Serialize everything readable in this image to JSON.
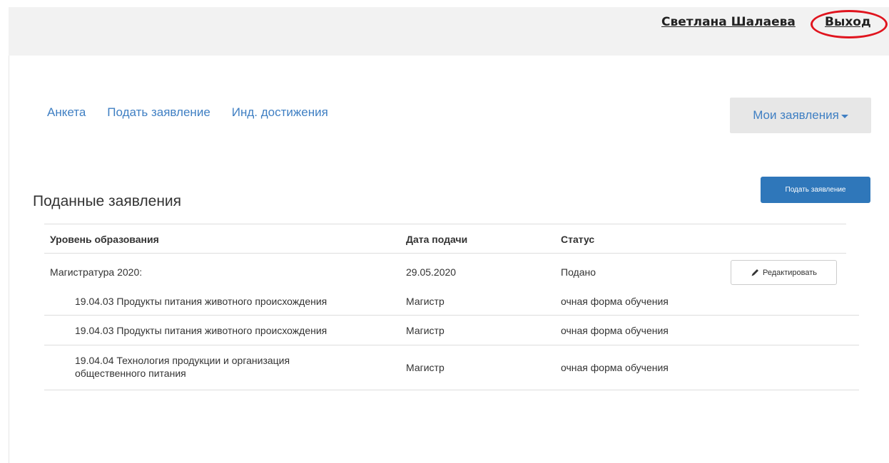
{
  "header": {
    "user_name": "Светлана Шалаева",
    "logout_label": "Выход"
  },
  "nav": {
    "items": [
      "Анкета",
      "Подать заявление",
      "Инд. достижения"
    ],
    "dropdown_label": "Мои заявления"
  },
  "main": {
    "title": "Поданные заявления",
    "submit_button_label": "Подать заявление",
    "table": {
      "columns": [
        "Уровень образования",
        "Дата подачи",
        "Статус"
      ],
      "group": {
        "name": "Магистратура 2020:",
        "date": "29.05.2020",
        "status": "Подано",
        "edit_label": "Редактировать"
      },
      "rows": [
        {
          "program": "19.04.03 Продукты питания животного происхождения",
          "degree": "Магистр",
          "form": "очная форма обучения"
        },
        {
          "program": "19.04.03 Продукты питания животного происхождения",
          "degree": "Магистр",
          "form": "очная форма обучения"
        },
        {
          "program": "19.04.04 Технология продукции и организация общественного питания",
          "degree": "Магистр",
          "form": "очная форма обучения"
        }
      ]
    }
  },
  "colors": {
    "link": "#3f7fc3",
    "primary_button": "#2f77ba",
    "highlight_circle": "#e0141e"
  },
  "icons": {
    "edit": "pencil-icon",
    "dropdown": "caret-down-icon"
  }
}
